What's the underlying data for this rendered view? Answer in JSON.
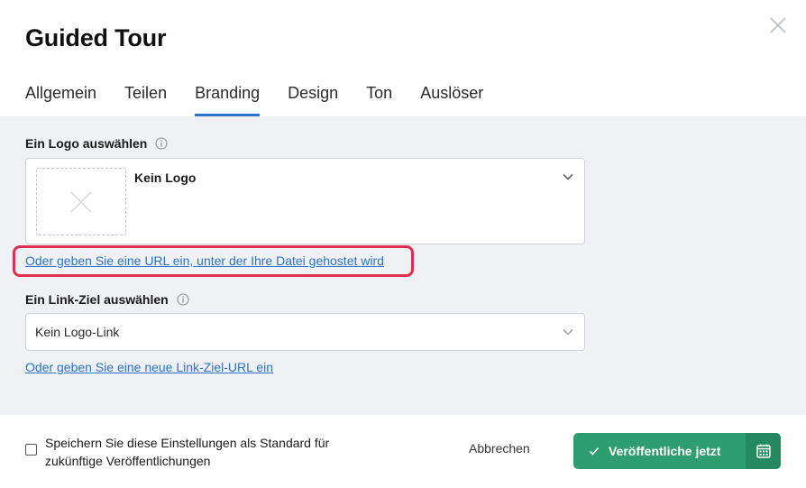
{
  "dialog": {
    "title": "Guided Tour",
    "close_icon": "close-icon"
  },
  "tabs": [
    {
      "label": "Allgemein",
      "active": false
    },
    {
      "label": "Teilen",
      "active": false
    },
    {
      "label": "Branding",
      "active": true
    },
    {
      "label": "Design",
      "active": false
    },
    {
      "label": "Ton",
      "active": false
    },
    {
      "label": "Auslöser",
      "active": false
    }
  ],
  "logo_section": {
    "label": "Ein Logo auswählen",
    "selected_value": "Kein Logo",
    "url_link": "Oder geben Sie eine URL ein, unter der Ihre Datei gehostet wird"
  },
  "link_target_section": {
    "label": "Ein Link-Ziel auswählen",
    "selected_value": "Kein Logo-Link",
    "new_link": "Oder geben Sie eine neue Link-Ziel-URL ein"
  },
  "footer": {
    "checkbox_label": "Speichern Sie diese Einstellungen als Standard für zukünftige Veröffentlichungen",
    "checkbox_checked": false,
    "cancel_label": "Abbrechen",
    "publish_label": "Veröffentliche jetzt"
  },
  "colors": {
    "accent": "#2b73c9",
    "highlight": "#e02f4c",
    "publish": "#2f9e6e",
    "schedule": "#24895d",
    "panel_bg": "#f0f1f4"
  }
}
